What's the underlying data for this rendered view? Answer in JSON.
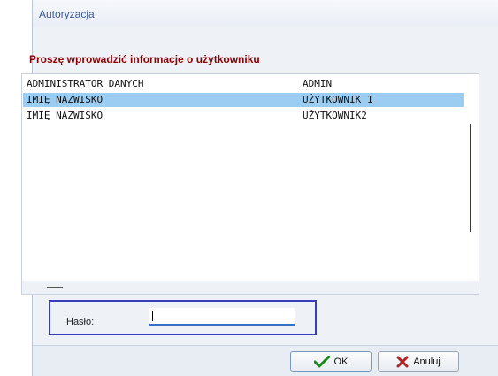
{
  "window": {
    "title": "Autoryzacja"
  },
  "prompt": "Proszę wprowadzić informacje o użytkowniku",
  "users": [
    {
      "name": "ADMINISTRATOR DANYCH",
      "role": "ADMIN",
      "selected": false
    },
    {
      "name": "IMIĘ NAZWISKO",
      "role": "UŻYTKOWNIK 1",
      "selected": true
    },
    {
      "name": "IMIĘ NAZWISKO",
      "role": "UŻYTKOWNIK2",
      "selected": false
    }
  ],
  "password": {
    "label": "Hasło:",
    "value": ""
  },
  "buttons": {
    "ok": {
      "label": "OK"
    },
    "cancel": {
      "label": "Anuluj"
    }
  },
  "icons": {
    "selection_arrow": "arrow-right-icon",
    "ok": "checkmark-icon",
    "cancel": "x-icon"
  },
  "colors": {
    "selected_row": "#9bcdf3",
    "prompt": "#8b0000",
    "highlight_frame": "#3b3bbd",
    "arrow": "#3b4fd1"
  }
}
